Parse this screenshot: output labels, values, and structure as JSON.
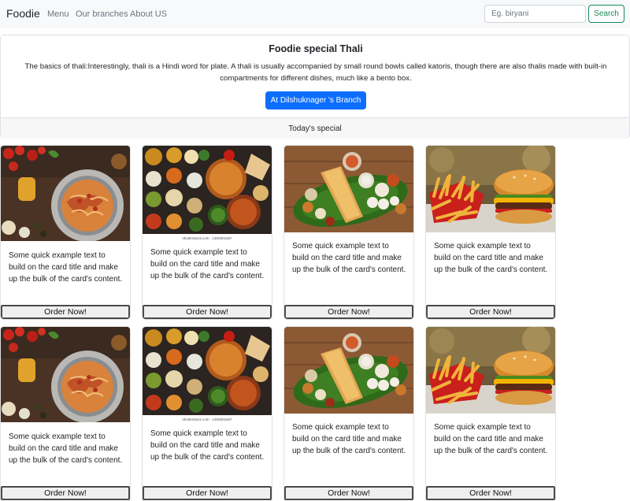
{
  "navbar": {
    "brand": "Foodie",
    "links": [
      "Menu",
      "Our branches",
      "About US"
    ],
    "search_placeholder": "Eg. biryani",
    "search_button": "Search"
  },
  "special": {
    "title": "Foodie special Thali",
    "text": "The basics of thali:Interestingly, thali is a Hindi word for plate. A thali is usually accompanied by small round bowls called katoris, though there are also thalis made with built-in compartments for different dishes, much like a bento box.",
    "button": "At Dilshuknager 's Branch",
    "footer": "Today's special"
  },
  "cards": [
    {
      "dish": "pasta",
      "text": "Some quick example text to build on the card title and make up the bulk of the card's content.",
      "button": "Order Now!"
    },
    {
      "dish": "indian-spread",
      "image_caption": "shutterstock.com · 1304901667",
      "text": "Some quick example text to build on the card title and make up the bulk of the card's content.",
      "button": "Order Now!"
    },
    {
      "dish": "dosa",
      "text": "Some quick example text to build on the card title and make up the bulk of the card's content.",
      "button": "Order Now!"
    },
    {
      "dish": "burger-fries",
      "text": "Some quick example text to build on the card title and make up the bulk of the card's content.",
      "button": "Order Now!"
    },
    {
      "dish": "pasta",
      "text": "Some quick example text to build on the card title and make up the bulk of the card's content.",
      "button": "Order Now!"
    },
    {
      "dish": "indian-spread",
      "image_caption": "shutterstock.com · 1304901667",
      "text": "Some quick example text to build on the card title and make up the bulk of the card's content.",
      "button": "Order Now!"
    },
    {
      "dish": "dosa",
      "text": "Some quick example text to build on the card title and make up the bulk of the card's content.",
      "button": "Order Now!"
    },
    {
      "dish": "burger-fries",
      "text": "Some quick example text to build on the card title and make up the bulk of the card's content.",
      "button": "Order Now!"
    }
  ],
  "colors": {
    "primary": "#0d6efd",
    "success": "#198754",
    "navbar_bg": "#f8f9fa"
  }
}
